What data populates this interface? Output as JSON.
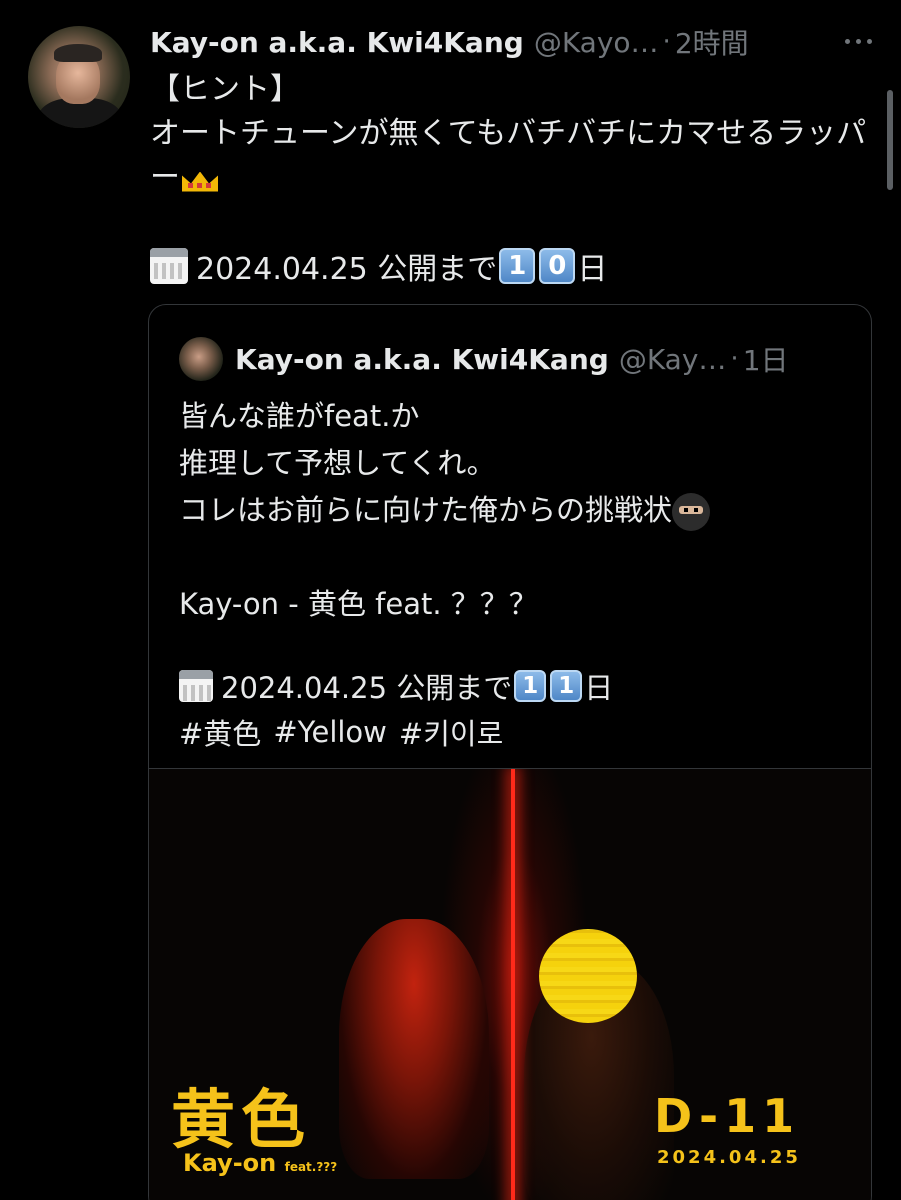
{
  "tweet": {
    "display_name": "Kay-on a.k.a. Kwi4Kang",
    "handle": "@Kayo…",
    "separator": "·",
    "timestamp": "2時間",
    "text": "【ヒント】\nオートチューンが無くてもバチバチにカマせるラッパー",
    "date_line": {
      "prefix": "2024.04.25  公開まで",
      "digits": [
        "1",
        "0"
      ],
      "suffix": "日"
    }
  },
  "quoted_tweet": {
    "display_name": "Kay-on a.k.a. Kwi4Kang",
    "handle": "@Kay…",
    "separator": "·",
    "timestamp": "1日",
    "text": "皆んな誰がfeat.か\n推理して予想してくれ。\nコレはお前らに向けた俺からの挑戦状",
    "text2": "\nKay-on - 黄色 feat. ？？？",
    "date_line": {
      "prefix": "2024.04.25 公開まで",
      "digits": [
        "1",
        "1"
      ],
      "suffix": "日"
    },
    "hashtags": [
      "#黄色",
      "#Yellow",
      "#키이로"
    ]
  },
  "poster": {
    "title": "黄色",
    "artist": "Kay-on",
    "feat": "feat.???",
    "countdown": "D-11",
    "date": "2024.04.25"
  },
  "icons": {
    "calendar": "calendar-icon",
    "crown": "crown-icon",
    "ninja": "ninja-icon",
    "more": "more-icon"
  },
  "colors": {
    "background": "#000000",
    "text": "#e7e9ea",
    "secondary": "#71767b",
    "poster_yellow": "#f5c21a",
    "laser_red": "#ff2a1a"
  }
}
